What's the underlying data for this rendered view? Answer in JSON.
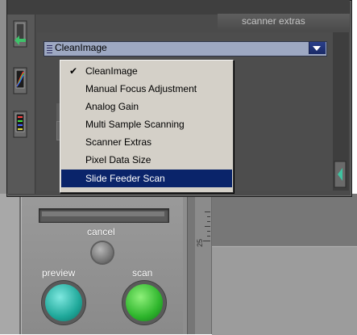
{
  "window": {
    "title": "scanner extras",
    "faded_top": "eeeeeee"
  },
  "combo": {
    "selected": "CleanImage"
  },
  "menu": {
    "items": [
      {
        "label": "CleanImage",
        "checked": true,
        "highlighted": false
      },
      {
        "label": "Manual Focus Adjustment",
        "checked": false,
        "highlighted": false
      },
      {
        "label": "Analog Gain",
        "checked": false,
        "highlighted": false
      },
      {
        "label": "Multi Sample Scanning",
        "checked": false,
        "highlighted": false
      },
      {
        "label": "Scanner Extras",
        "checked": false,
        "highlighted": false
      },
      {
        "label": "Pixel Data Size",
        "checked": false,
        "highlighted": false
      },
      {
        "label": "Slide Feeder Scan",
        "checked": false,
        "highlighted": true
      }
    ],
    "check_glyph": "✔"
  },
  "controls": {
    "cancel_label": "cancel",
    "preview_label": "preview",
    "scan_label": "scan"
  },
  "ruler": {
    "label": "25"
  },
  "colors": {
    "menu_highlight": "#0a246a",
    "combo_fill": "#9da8c2",
    "preview_button": "#1fa89a",
    "scan_button": "#2eb52c"
  }
}
